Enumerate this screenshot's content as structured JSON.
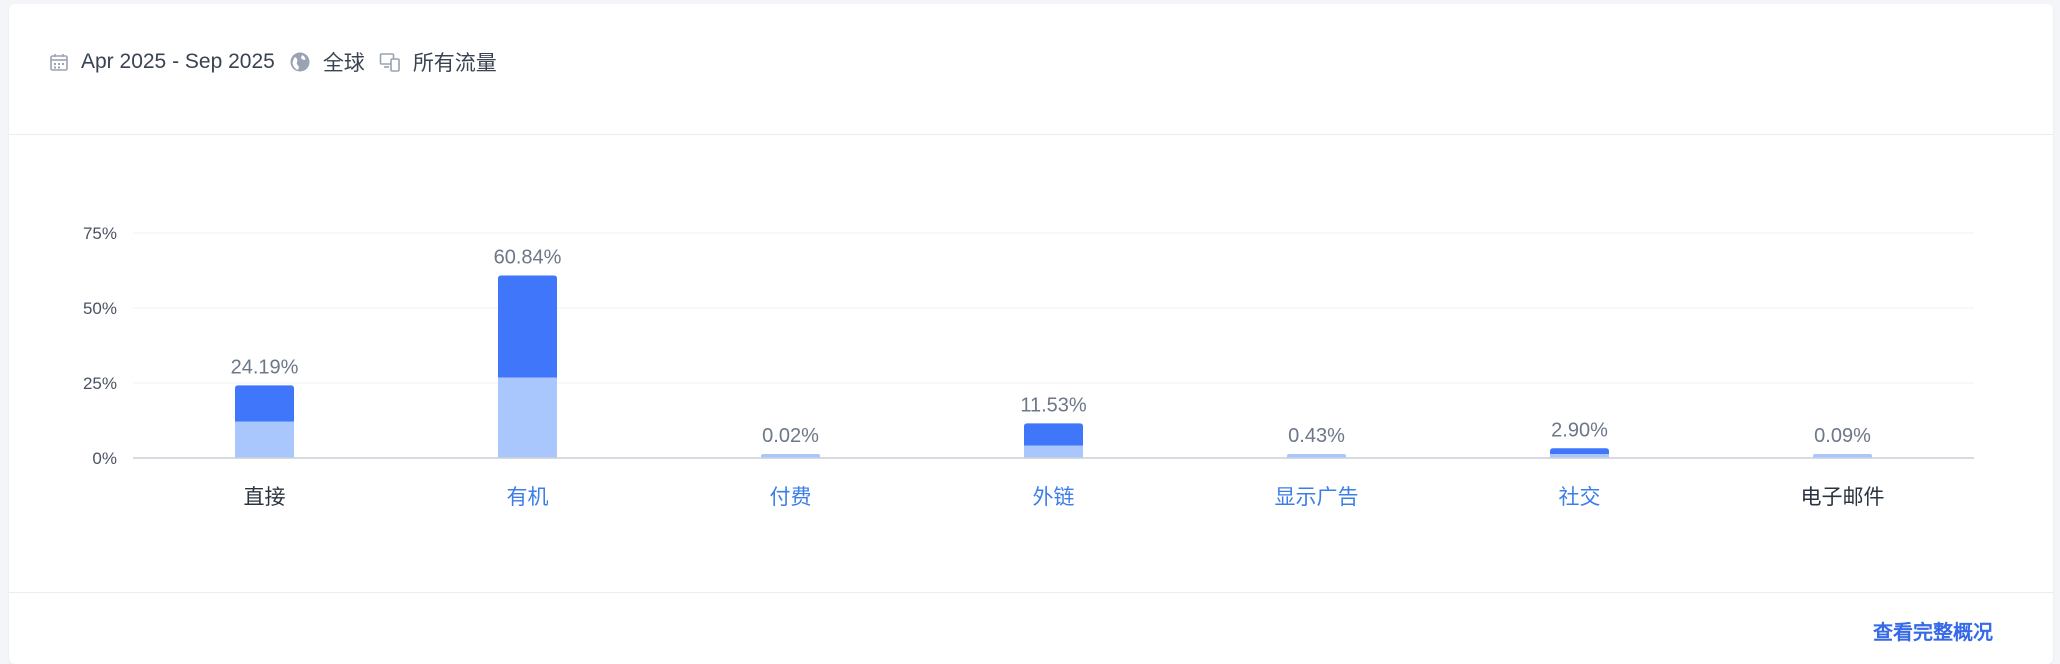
{
  "filters": {
    "date_range": "Apr 2025 - Sep 2025",
    "region": "全球",
    "traffic": "所有流量"
  },
  "footer": {
    "link_label": "查看完整概况"
  },
  "colors": {
    "series_dark": "#3f76fa",
    "series_light": "#a9c6fd",
    "label_active": "#3c7ee8",
    "label_default": "#2b3340",
    "value_label": "#6c7788",
    "grid": "#eef0f4",
    "axis": "#c9cfd8"
  },
  "chart_data": {
    "type": "bar",
    "stacked": true,
    "categories": [
      "直接",
      "有机",
      "付费",
      "外链",
      "显示广告",
      "社交",
      "电子邮件"
    ],
    "category_active": [
      false,
      true,
      true,
      true,
      true,
      true,
      false
    ],
    "totals": [
      24.19,
      60.84,
      0.02,
      11.53,
      0.43,
      2.9,
      0.09
    ],
    "total_labels": [
      "24.19%",
      "60.84%",
      "0.02%",
      "11.53%",
      "0.43%",
      "2.90%",
      "0.09%"
    ],
    "series": [
      {
        "values": [
          12.1,
          26.8,
          0.02,
          4.1,
          0.43,
          1.0,
          0.09
        ]
      },
      {
        "values": [
          12.09,
          34.04,
          0.0,
          7.43,
          0.0,
          1.9,
          0.0
        ]
      }
    ],
    "yticks": [
      "75%",
      "50%",
      "25%",
      "0%"
    ],
    "ytick_values": [
      75,
      50,
      25,
      0
    ],
    "ylim": [
      0,
      75
    ],
    "grid": true
  }
}
